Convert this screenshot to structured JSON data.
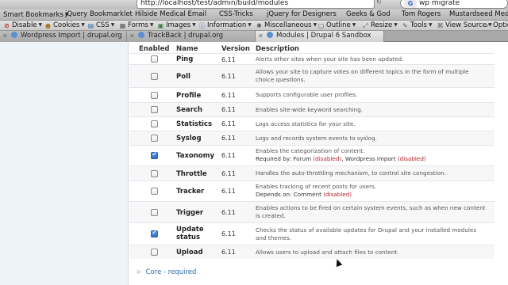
{
  "browser": {
    "url": "http://localhost/test/admin/build/modules",
    "search": "wp migrate",
    "search_engine_glyph": "G"
  },
  "bookmarks": [
    "Smart Bookmarks",
    "jQuery Bookmarklet",
    "Hilside Medical Email",
    "CSS-Tricks",
    "jQuery for Designers",
    "Geeks & God",
    "Tom Rogers",
    "Mustardseed Media I..."
  ],
  "devtools": [
    {
      "label": "Disable",
      "icon": "no-icon"
    },
    {
      "label": "Cookies",
      "icon": "cookie-icon"
    },
    {
      "label": "CSS",
      "icon": "css-icon"
    },
    {
      "label": "Forms",
      "icon": "forms-icon"
    },
    {
      "label": "Images",
      "icon": "images-icon"
    },
    {
      "label": "Information",
      "icon": "info-icon"
    },
    {
      "label": "Miscellaneous",
      "icon": "misc-icon"
    },
    {
      "label": "Outline",
      "icon": "outline-icon"
    },
    {
      "label": "Resize",
      "icon": "resize-icon"
    },
    {
      "label": "Tools",
      "icon": "tools-icon"
    },
    {
      "label": "View Source",
      "icon": "source-icon"
    },
    {
      "label": "Optio",
      "icon": "options-icon"
    }
  ],
  "tabs": [
    {
      "label": "Wordpress Import | drupal.org",
      "active": false
    },
    {
      "label": "TrackBack | drupal.org",
      "active": false
    },
    {
      "label": "Modules | Drupal 6 Sandbox",
      "active": true
    }
  ],
  "table": {
    "headers": {
      "enabled": "Enabled",
      "name": "Name",
      "version": "Version",
      "description": "Description"
    },
    "rows": [
      {
        "name": "Ping",
        "version": "6.11",
        "checked": false,
        "description": "Alerts other sites when your site has been updated."
      },
      {
        "name": "Poll",
        "version": "6.11",
        "checked": false,
        "description": "Allows your site to capture votes on different topics in the form of multiple choice questions."
      },
      {
        "name": "Profile",
        "version": "6.11",
        "checked": false,
        "description": "Supports configurable user profiles."
      },
      {
        "name": "Search",
        "version": "6.11",
        "checked": false,
        "description": "Enables site-wide keyword searching."
      },
      {
        "name": "Statistics",
        "version": "6.11",
        "checked": false,
        "description": "Logs access statistics for your site."
      },
      {
        "name": "Syslog",
        "version": "6.11",
        "checked": false,
        "description": "Logs and records system events to syslog."
      },
      {
        "name": "Taxonomy",
        "version": "6.11",
        "checked": true,
        "description": "Enables the categorization of content.",
        "req_label": "Required by: ",
        "req_1": "Forum ",
        "req_1_state": "(disabled)",
        "req_sep": ", ",
        "req_2": "Wordpress import ",
        "req_2_state": "(disabled)"
      },
      {
        "name": "Throttle",
        "version": "6.11",
        "checked": false,
        "description": "Handles the auto-throttling mechanism, to control site congestion."
      },
      {
        "name": "Tracker",
        "version": "6.11",
        "checked": false,
        "description": "Enables tracking of recent posts for users.",
        "dep_label": "Depends on: ",
        "dep_1": "Comment ",
        "dep_1_state": "(disabled)"
      },
      {
        "name": "Trigger",
        "version": "6.11",
        "checked": false,
        "description": "Enables actions to be fired on certain system events, such as when new content is created."
      },
      {
        "name": "Update status",
        "name_line1": "Update",
        "name_line2": "status",
        "version": "6.11",
        "checked": true,
        "description": "Checks the status of available updates for Drupal and your installed modules and themes."
      },
      {
        "name": "Upload",
        "version": "6.11",
        "checked": false,
        "description": "Allows users to upload and attach files to content."
      }
    ]
  },
  "fieldset": {
    "label": "Core - required"
  }
}
